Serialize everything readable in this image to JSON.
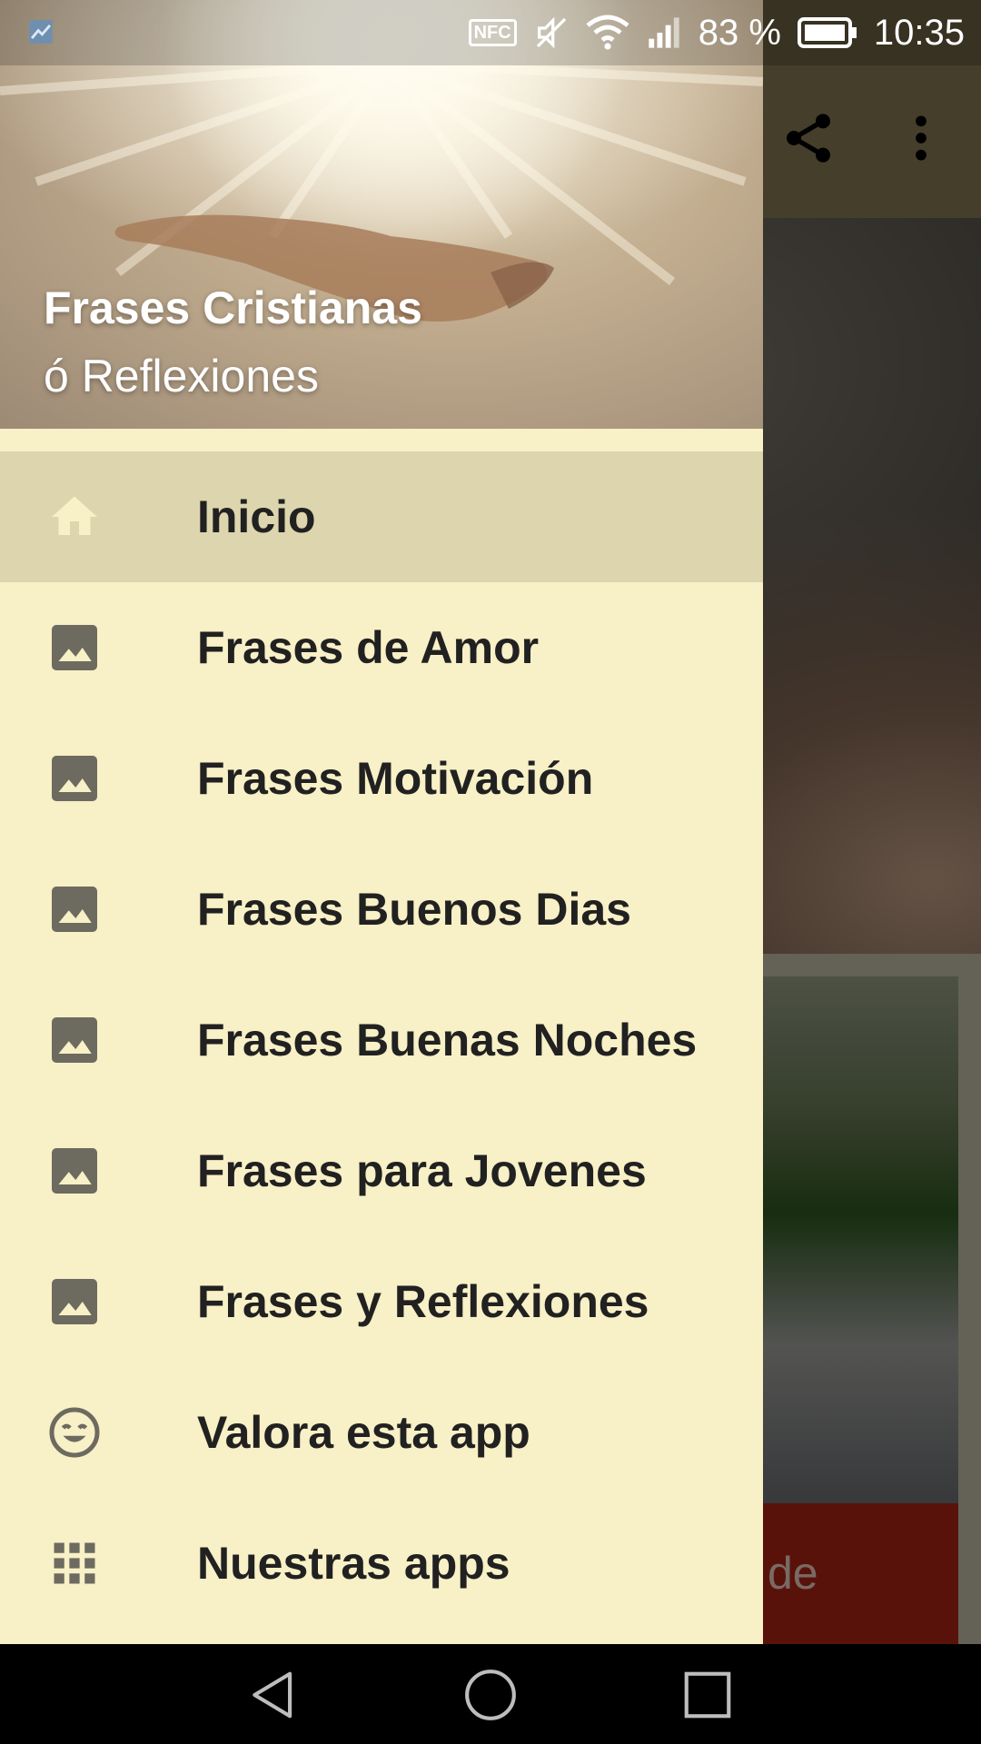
{
  "status_bar": {
    "nfc": "NFC",
    "battery_percent": "83 %",
    "time": "10:35"
  },
  "background": {
    "partial_text": "de"
  },
  "drawer": {
    "header": {
      "title": "Frases Cristianas",
      "subtitle": "ó Reflexiones"
    },
    "items": [
      {
        "label": "Inicio",
        "icon": "home-icon",
        "active": true
      },
      {
        "label": "Frases de Amor",
        "icon": "image-icon"
      },
      {
        "label": "Frases Motivación",
        "icon": "image-icon"
      },
      {
        "label": "Frases Buenos Dias",
        "icon": "image-icon"
      },
      {
        "label": "Frases Buenas Noches",
        "icon": "image-icon"
      },
      {
        "label": "Frases para Jovenes",
        "icon": "image-icon"
      },
      {
        "label": "Frases y Reflexiones",
        "icon": "image-icon"
      },
      {
        "label": "Valora esta app",
        "icon": "smiley-icon"
      },
      {
        "label": "Nuestras apps",
        "icon": "apps-grid-icon"
      }
    ]
  },
  "colors": {
    "drawer_bg": "#f8f0c6",
    "active_item_bg": "#dcd5ae",
    "icon_color": "#6d6a60",
    "home_icon_color": "#f8f0c6",
    "toolbar": "#8b7d55"
  }
}
